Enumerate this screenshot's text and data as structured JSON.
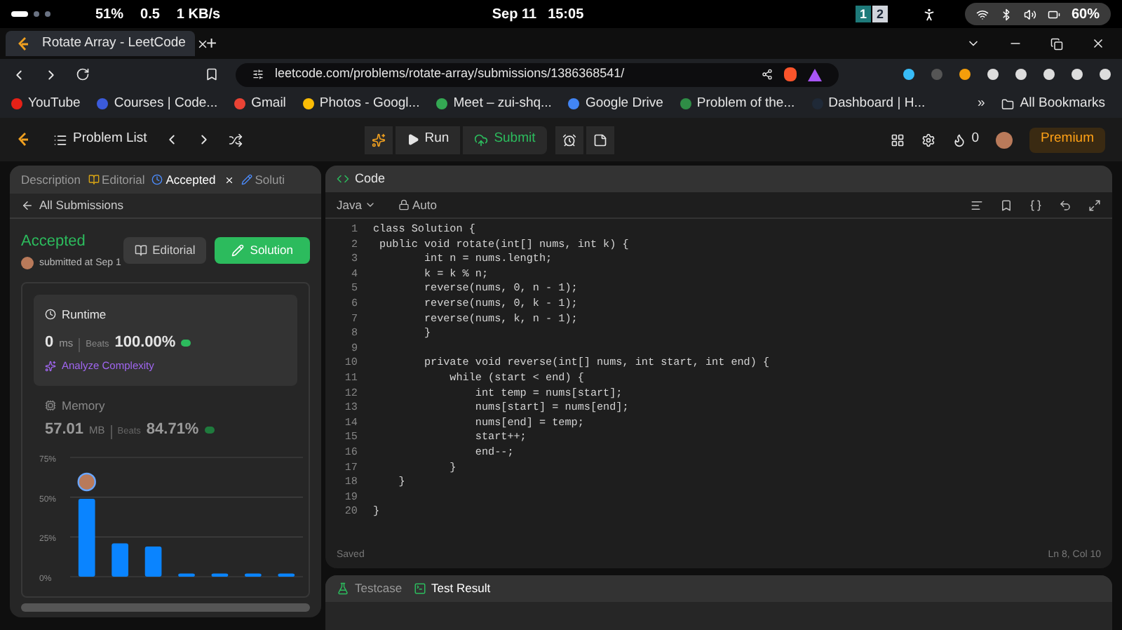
{
  "system_bar": {
    "stats": [
      "51%",
      "0.5",
      "1 KB/s"
    ],
    "date": "Sep 11",
    "time": "15:05",
    "workspaces": [
      {
        "label": "1",
        "selected": true
      },
      {
        "label": "2",
        "selected": false
      }
    ],
    "battery": "60%"
  },
  "browser": {
    "tabs": [
      {
        "title": "Rotate Array - LeetCode",
        "selected": true
      }
    ],
    "new_tab": "+",
    "url": "leetcode.com/problems/rotate-array/submissions/1386368541/",
    "bookmarks": [
      {
        "label": "YouTube",
        "color": "#e62117"
      },
      {
        "label": "Courses | Code...",
        "color": "#3b5bdb"
      },
      {
        "label": "Gmail",
        "color": "#ea4335"
      },
      {
        "label": "Photos - Googl...",
        "color": "#fbbc05"
      },
      {
        "label": "Meet – zui-shq...",
        "color": "#34a853"
      },
      {
        "label": "Google Drive",
        "color": "#4285f4"
      },
      {
        "label": "Problem of the...",
        "color": "#2f8d46"
      },
      {
        "label": "Dashboard | H...",
        "color": "#1f2937"
      }
    ],
    "more": "»",
    "all_bookmarks": "All Bookmarks"
  },
  "toolbar": {
    "problem_list": "Problem List",
    "run": "Run",
    "submit": "Submit",
    "streak": "0",
    "premium": "Premium"
  },
  "left_panel": {
    "tabs": [
      {
        "label": "Description",
        "selected": false
      },
      {
        "label": "Editorial",
        "selected": false
      },
      {
        "label": "Accepted",
        "selected": true
      },
      {
        "label": "Soluti",
        "selected": false
      }
    ],
    "back": "All Submissions",
    "status": "Accepted",
    "submitted": "submitted at Sep 1",
    "buttons": [
      "Editorial",
      "Solution"
    ],
    "runtime": {
      "title": "Runtime",
      "value": "0",
      "unit": "ms",
      "beats_label": "Beats",
      "beats": "100.00%",
      "analyze": "Analyze Complexity"
    },
    "memory": {
      "title": "Memory",
      "value": "57.01",
      "unit": "MB",
      "beats_label": "Beats",
      "beats": "84.71%"
    },
    "chart_data": {
      "type": "bar",
      "ylim": [
        0,
        75
      ],
      "yticks": [
        {
          "value": 0,
          "label": "0%"
        },
        {
          "value": 25,
          "label": "25%"
        },
        {
          "value": 50,
          "label": "50%"
        },
        {
          "value": 75,
          "label": "75%"
        }
      ],
      "values": [
        49,
        21,
        19,
        2,
        2,
        2,
        2
      ]
    }
  },
  "editor": {
    "title": "Code",
    "language": "Java",
    "mode": "Auto",
    "lines": [
      {
        "number": "1",
        "code": "class Solution {"
      },
      {
        "number": "2",
        "code": " public void rotate(int[] nums, int k) {"
      },
      {
        "number": "3",
        "code": "        int n = nums.length;"
      },
      {
        "number": "4",
        "code": "        k = k % n;"
      },
      {
        "number": "5",
        "code": "        reverse(nums, 0, n - 1);"
      },
      {
        "number": "6",
        "code": "        reverse(nums, 0, k - 1);"
      },
      {
        "number": "7",
        "code": "        reverse(nums, k, n - 1);"
      },
      {
        "number": "8",
        "code": "        }"
      },
      {
        "number": "9"
      },
      {
        "number": "10",
        "code": "        private void reverse(int[] nums, int start, int end) {"
      },
      {
        "number": "11",
        "code": "            while (start < end) {"
      },
      {
        "number": "12",
        "code": "                int temp = nums[start];"
      },
      {
        "number": "13",
        "code": "                nums[start] = nums[end];"
      },
      {
        "number": "14",
        "code": "                nums[end] = temp;"
      },
      {
        "number": "15",
        "code": "                start++;"
      },
      {
        "number": "16",
        "code": "                end--;"
      },
      {
        "number": "17",
        "code": "            }"
      },
      {
        "number": "18",
        "code": "    }"
      },
      {
        "number": "19"
      },
      {
        "number": "20",
        "code": "}"
      }
    ],
    "status": "Saved",
    "position": "Ln 8, Col 10"
  },
  "console": {
    "tabs": [
      {
        "label": "Testcase",
        "selected": false
      },
      {
        "label": "Test Result",
        "selected": true
      }
    ]
  }
}
